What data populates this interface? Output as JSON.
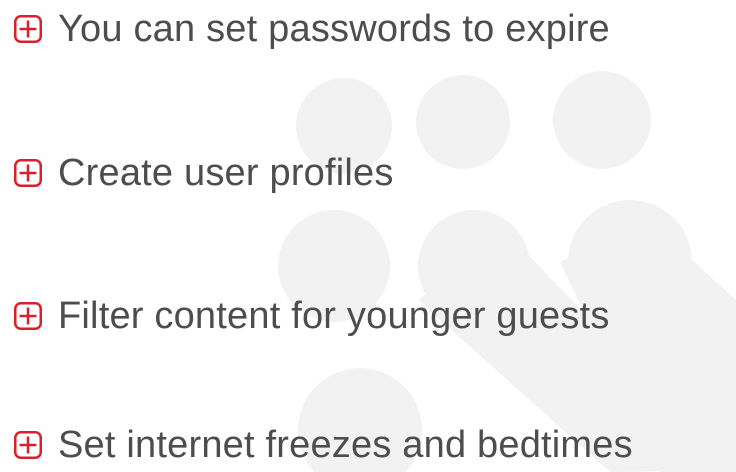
{
  "features": [
    {
      "label": "You can set passwords to expire",
      "icon": "plus-square-icon"
    },
    {
      "label": "Create user profiles",
      "icon": "plus-square-icon"
    },
    {
      "label": "Filter content for younger guests",
      "icon": "plus-square-icon"
    },
    {
      "label": "Set internet freezes and bedtimes",
      "icon": "plus-square-icon"
    }
  ],
  "colors": {
    "accent": "#d9202c",
    "text": "#4d4d4d",
    "watermark": "#f2f2f2",
    "background": "#ffffff"
  },
  "watermark": {
    "icon": "people-watermark-icon"
  }
}
